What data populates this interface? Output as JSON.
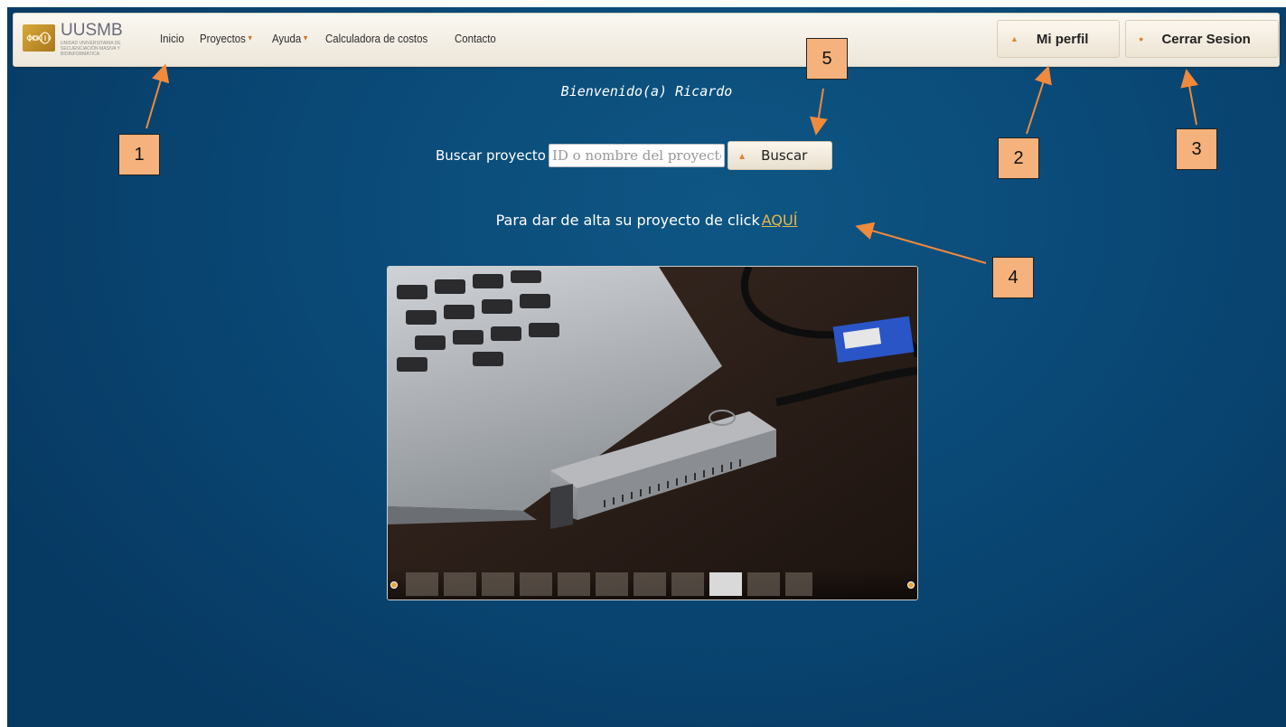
{
  "brand": {
    "name": "UUSMB",
    "subtitle": "UNIDAD UNIVERSITARIA DE SECUENCIACIÓN MASIVA Y BIOINFORMÁTICA"
  },
  "nav": {
    "items": [
      {
        "label": "Inicio",
        "has_dropdown": false
      },
      {
        "label": "Proyectos",
        "has_dropdown": true
      },
      {
        "label": "Ayuda",
        "has_dropdown": true
      },
      {
        "label": "Calculadora de costos",
        "has_dropdown": false
      },
      {
        "label": "Contacto",
        "has_dropdown": false
      }
    ],
    "dropdown_caret": "▾",
    "profile_label": "Mi perfil",
    "logout_label": "Cerrar Sesion",
    "button_dot": "▲",
    "logout_dot": "●"
  },
  "welcome": "Bienvenido(a) Ricardo",
  "search": {
    "label": "Buscar proyecto",
    "placeholder": "ID o nombre del proyecto",
    "button_label": "Buscar",
    "button_dot": "▲"
  },
  "signup": {
    "text": "Para dar de alta su proyecto de click",
    "link": "AQUÍ"
  },
  "callouts": [
    "1",
    "2",
    "3",
    "4",
    "5"
  ],
  "colors": {
    "background": "#0a4a78",
    "accent": "#e8b84a",
    "callout_fill": "#f6b27c",
    "arrow": "#f08a3c"
  }
}
